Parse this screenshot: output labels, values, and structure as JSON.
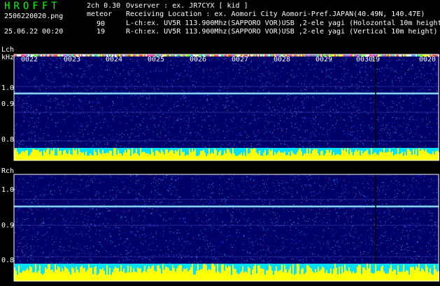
{
  "header": {
    "title": "HROFFT",
    "mode": "2ch 0.30",
    "meteor_label": "meteor",
    "count_l": "90",
    "count_r": "19",
    "filename": "2506220020.png",
    "datetime": "25.06.22 00:20"
  },
  "info": {
    "observer": "Ovserver              : ex. JR7CYX [ kid ]",
    "location": "Receiving Location : ex. Aomori City Aomori-Pref.JAPAN(40.49N, 140.47E)",
    "lch": "L-ch:ex. UV5R 113.900Mhz(SAPPORO VOR)USB ,2-ele yagi (Holozontal 10m height)",
    "rch": "R-ch:ex. UV5R 113.900Mhz(SAPPORO VOR)USB ,2-ele yagi (Vertical 10m height)"
  },
  "lch": {
    "label": "Lch",
    "unit": "kHz",
    "ticks": [
      "1.0",
      "0.9",
      "0.8"
    ],
    "time_labels": [
      "0022",
      "0023",
      "0024",
      "0025",
      "0026",
      "0027",
      "0028",
      "0029",
      "0030",
      "19",
      "0020"
    ]
  },
  "rch": {
    "label": "Rch",
    "ticks": [
      "1.0",
      "0.9",
      "0.8"
    ]
  },
  "colors": {
    "title": "#00ff00",
    "spectrum_bg": "#000066",
    "signal_line": "#ffffff",
    "level_bar": "#ffff00",
    "level_base": "#00e0ff"
  }
}
